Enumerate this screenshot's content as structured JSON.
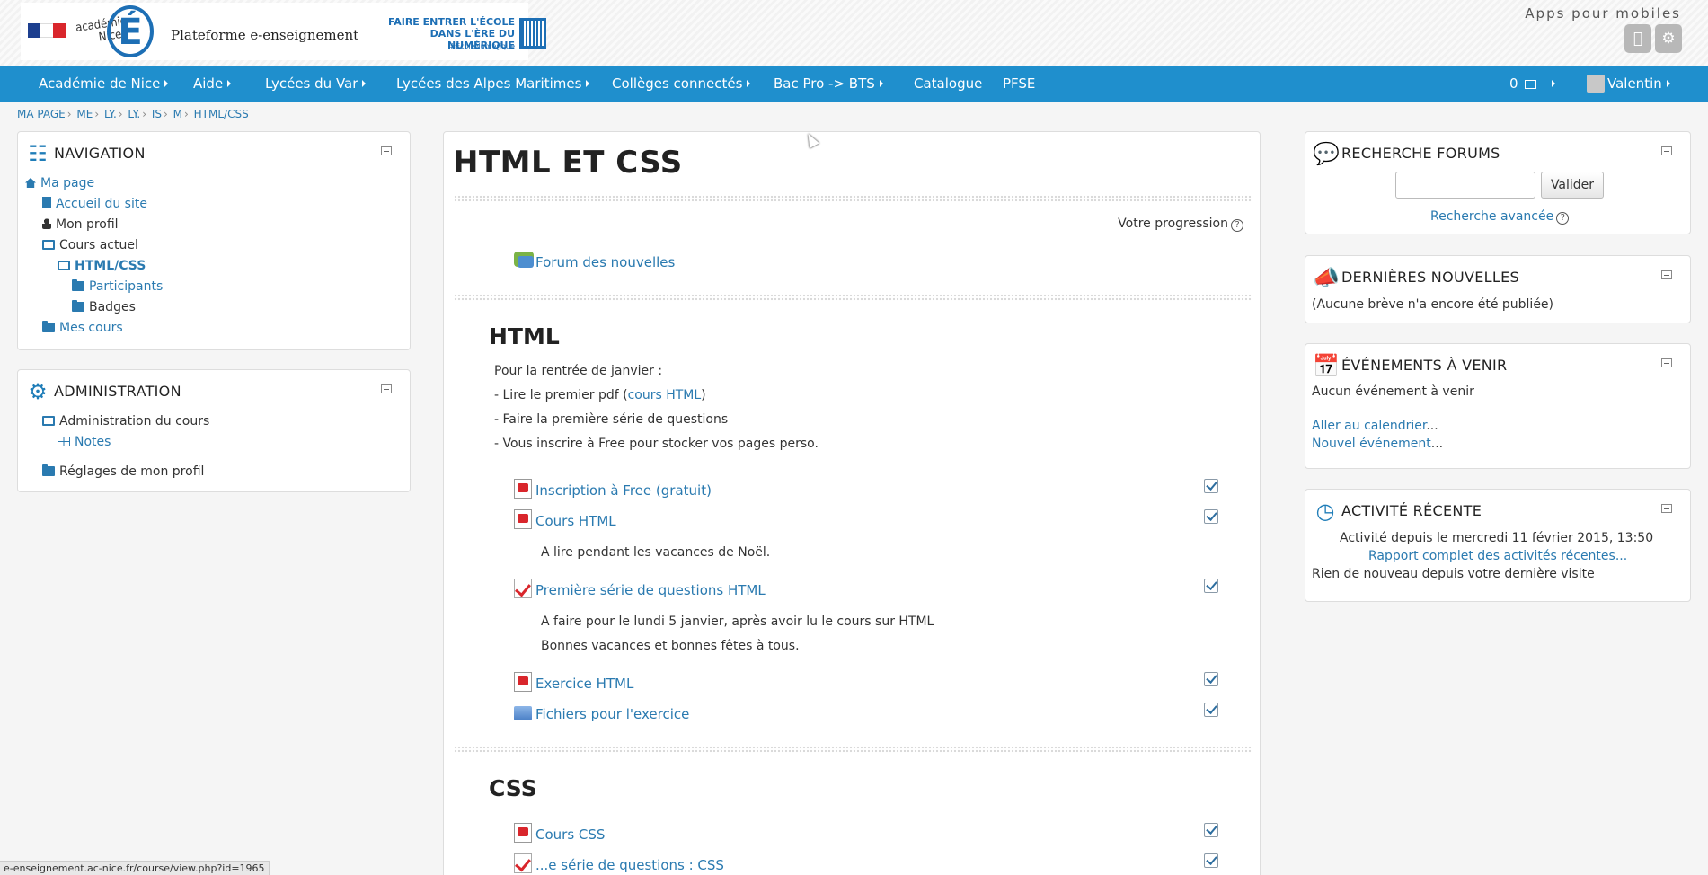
{
  "header": {
    "platform_title": "Plateforme e-enseignement",
    "academie_line1": "académie",
    "academie_line2": "Nice",
    "logo_letter": "É",
    "banner_line1": "FAIRE ENTRER L'ÉCOLE",
    "banner_line2": "DANS L'ÈRE DU NUMÉRIQUE",
    "banner_tag": "#EcoleNumerique",
    "apps_label": "Apps pour mobiles"
  },
  "navbar": {
    "items": [
      {
        "label": "Académie de Nice"
      },
      {
        "label": "Aide"
      },
      {
        "label": "Lycées du Var"
      },
      {
        "label": "Lycées des Alpes Maritimes"
      },
      {
        "label": "Collèges connectés"
      },
      {
        "label": "Bac Pro -> BTS"
      },
      {
        "label": "Catalogue"
      },
      {
        "label": "PFSE"
      }
    ],
    "messages_count": "0",
    "user_name": "Valentin"
  },
  "breadcrumb": [
    "MA PAGE",
    "ME",
    "LY.",
    "LY.",
    "IS",
    "M",
    "HTML/CSS"
  ],
  "navigation": {
    "title": "NAVIGATION",
    "items": [
      {
        "label": "Ma page"
      },
      {
        "label": "Accueil du site"
      },
      {
        "label": "Mon profil"
      },
      {
        "label": "Cours actuel"
      },
      {
        "label": "HTML/CSS"
      },
      {
        "label": "Participants"
      },
      {
        "label": "Badges"
      },
      {
        "label": "Mes cours"
      }
    ]
  },
  "administration": {
    "title": "ADMINISTRATION",
    "items": [
      {
        "label": "Administration du cours"
      },
      {
        "label": "Notes"
      },
      {
        "label": "Réglages de mon profil"
      }
    ]
  },
  "course": {
    "title": "HTML ET CSS",
    "progress_label": "Votre progression",
    "forum_label": "Forum des nouvelles",
    "sections": [
      {
        "title": "HTML",
        "summary": [
          "Pour la rentrée de janvier :",
          "- Lire le premier pdf (",
          "cours HTML",
          ")",
          "- Faire la première série de questions",
          "- Vous inscrire à Free pour stocker vos pages perso."
        ],
        "activities": [
          {
            "label": "Inscription à Free (gratuit)"
          },
          {
            "label": "Cours HTML",
            "desc": "A lire pendant les vacances de Noël."
          },
          {
            "label": "Première série de questions HTML",
            "desc1": "A faire pour le lundi 5 janvier, après avoir lu le cours sur HTML",
            "desc2": "Bonnes vacances et bonnes fêtes à tous."
          },
          {
            "label": "Exercice HTML"
          },
          {
            "label": "Fichiers pour l'exercice"
          }
        ]
      },
      {
        "title": "CSS",
        "activities": [
          {
            "label": "Cours CSS"
          },
          {
            "label": "...e série de questions : CSS"
          }
        ]
      }
    ]
  },
  "forum_search": {
    "title": "RECHERCHE FORUMS",
    "button_label": "Valider",
    "advanced_link": "Recherche avancée"
  },
  "latest_news": {
    "title": "DERNIÈRES NOUVELLES",
    "empty_text": "(Aucune brève n'a encore été publiée)"
  },
  "upcoming_events": {
    "title": "ÉVÉNEMENTS À VENIR",
    "empty_text": "Aucun événement à venir",
    "calendar_link": "Aller au calendrier",
    "new_event_link": "Nouvel événement",
    "ellipsis": "..."
  },
  "recent_activity": {
    "title": "ACTIVITÉ RÉCENTE",
    "since_text": "Activité depuis le mercredi 11 février 2015, 13:50",
    "report_link": "Rapport complet des activités récentes...",
    "nothing_new": "Rien de nouveau depuis votre dernière visite"
  },
  "status_bar": {
    "url": "e-enseignement.ac-nice.fr/course/view.php?id=1965"
  },
  "colors": {
    "navbar": "#1f8fcd",
    "link": "#2a7ab0",
    "brand_blue": "#1d6fb5"
  }
}
